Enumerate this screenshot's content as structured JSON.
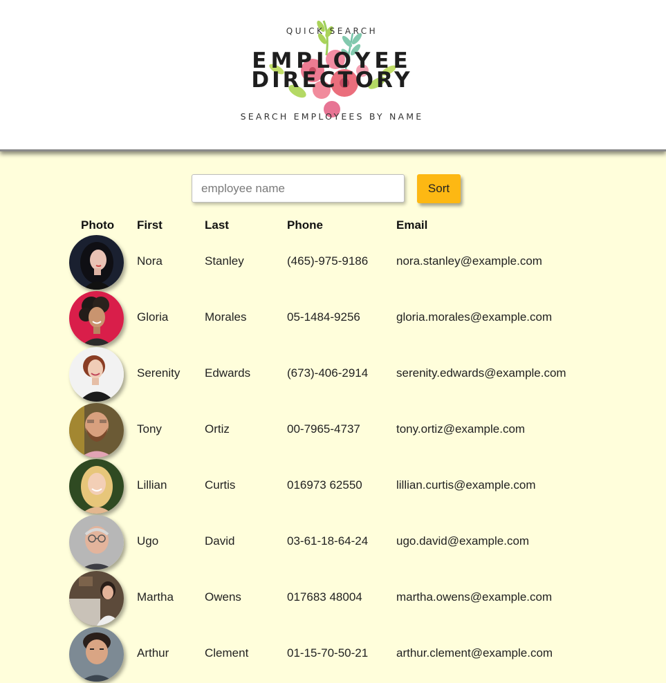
{
  "header": {
    "logo_top": "QUICK SEARCH",
    "logo_title_line1": "EMPLOYEE",
    "logo_title_line2": "DIRECTORY",
    "logo_bottom": "SEARCH EMPLOYEES BY NAME"
  },
  "search": {
    "placeholder": "employee name",
    "value": "",
    "sort_label": "Sort",
    "sort_color": "#fdb813"
  },
  "table": {
    "headers": [
      "Photo",
      "First",
      "Last",
      "Phone",
      "Email"
    ],
    "rows": [
      {
        "first": "Nora",
        "last": "Stanley",
        "phone": "(465)-975-9186",
        "email": "nora.stanley@example.com",
        "photo": "woman-dark-hair-portrait"
      },
      {
        "first": "Gloria",
        "last": "Morales",
        "phone": "05-1484-9256",
        "email": "gloria.morales@example.com",
        "photo": "woman-curly-hair-portrait"
      },
      {
        "first": "Serenity",
        "last": "Edwards",
        "phone": "(673)-406-2914",
        "email": "serenity.edwards@example.com",
        "photo": "woman-red-hair-portrait"
      },
      {
        "first": "Tony",
        "last": "Ortiz",
        "phone": "00-7965-4737",
        "email": "tony.ortiz@example.com",
        "photo": "man-beard-portrait"
      },
      {
        "first": "Lillian",
        "last": "Curtis",
        "phone": "016973 62550",
        "email": "lillian.curtis@example.com",
        "photo": "woman-blonde-portrait"
      },
      {
        "first": "Ugo",
        "last": "David",
        "phone": "03-61-18-64-24",
        "email": "ugo.david@example.com",
        "photo": "man-glasses-portrait"
      },
      {
        "first": "Martha",
        "last": "Owens",
        "phone": "017683 48004",
        "email": "martha.owens@example.com",
        "photo": "woman-laptop-portrait"
      },
      {
        "first": "Arthur",
        "last": "Clement",
        "phone": "01-15-70-50-21",
        "email": "arthur.clement@example.com",
        "photo": "man-dark-hair-portrait"
      }
    ]
  },
  "colors": {
    "page_background": "#fffedb",
    "header_background": "#ffffff",
    "sort_button": "#fdb813"
  }
}
